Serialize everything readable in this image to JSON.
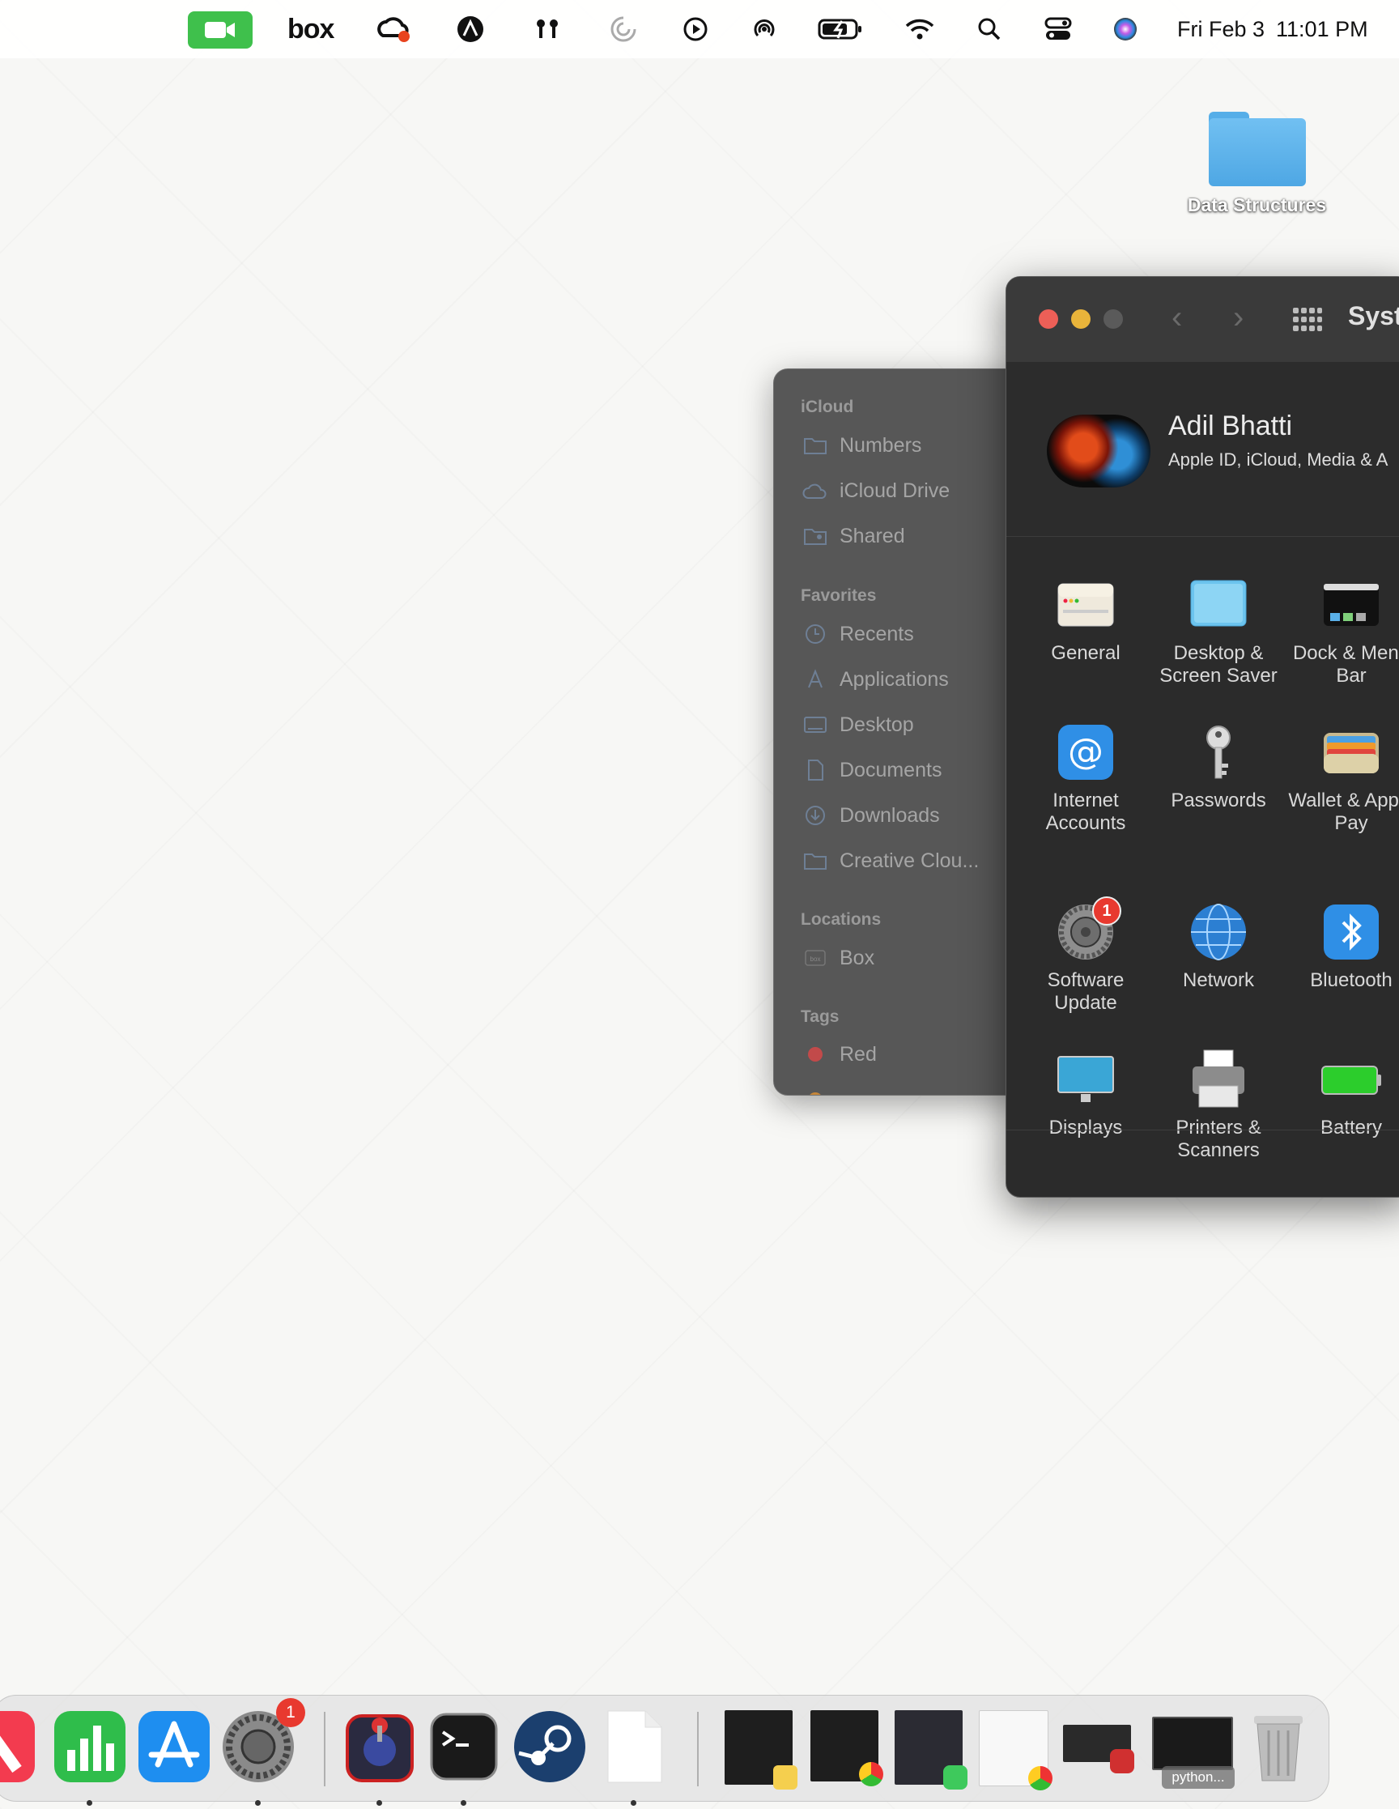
{
  "menubar": {
    "box_label": "box",
    "clock": {
      "date": "Fri Feb 3",
      "time": "11:01 PM"
    },
    "icons": [
      "facetime-icon",
      "box-icon",
      "creative-cloud-icon",
      "astro-icon",
      "airpods-icon",
      "focus-icon",
      "play-icon",
      "airdrop-icon",
      "battery-icon",
      "wifi-icon",
      "search-icon",
      "control-center-icon",
      "siri-icon"
    ]
  },
  "desktop": {
    "folder_label": "Data Structures"
  },
  "finder": {
    "sections": {
      "icloud": "iCloud",
      "favorites": "Favorites",
      "locations": "Locations",
      "tags": "Tags"
    },
    "icloud_items": [
      "Numbers",
      "iCloud Drive",
      "Shared"
    ],
    "favorite_items": [
      "Recents",
      "Applications",
      "Desktop",
      "Documents",
      "Downloads",
      "Creative Clou..."
    ],
    "location_items": [
      "Box"
    ],
    "tag_items": [
      "Red"
    ]
  },
  "system_preferences": {
    "title": "Syst",
    "user": {
      "name": "Adil Bhatti",
      "subtitle": "Apple ID, iCloud, Media & A"
    },
    "panes": [
      {
        "label": "General",
        "icon": "general-icon"
      },
      {
        "label": "Desktop & Screen Saver",
        "icon": "desktop-screensaver-icon"
      },
      {
        "label": "Dock & Menu Bar",
        "icon": "dock-menubar-icon"
      },
      {
        "label": "Internet Accounts",
        "icon": "at-icon"
      },
      {
        "label": "Passwords",
        "icon": "key-icon"
      },
      {
        "label": "Wallet & Apple Pay",
        "icon": "wallet-icon"
      },
      {
        "label": "Software Update",
        "icon": "gear-icon",
        "badge": "1"
      },
      {
        "label": "Network",
        "icon": "globe-icon"
      },
      {
        "label": "Bluetooth",
        "icon": "bluetooth-icon"
      },
      {
        "label": "Displays",
        "icon": "display-icon"
      },
      {
        "label": "Printers & Scanners",
        "icon": "printer-icon"
      },
      {
        "label": "Battery",
        "icon": "battery-icon"
      }
    ]
  },
  "dock": {
    "apps": [
      "news-icon",
      "numbers-icon",
      "app-store-icon",
      "system-preferences-icon",
      "clipboard-app-icon",
      "terminal-icon",
      "steam-icon",
      "document-icon"
    ],
    "system_prefs_badge": "1",
    "minimized": [
      "notes-window",
      "chrome-window",
      "messages-window",
      "chrome-window-2",
      "photo-booth-window",
      "python-window"
    ],
    "python_caption": "python...",
    "trash": "trash-icon"
  }
}
